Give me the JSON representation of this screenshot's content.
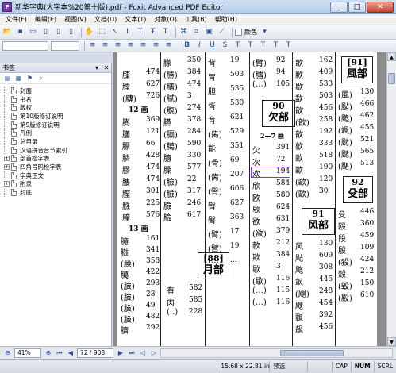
{
  "window": {
    "title": "新华字典(大字本%20第十版).pdf - Foxit Advanced PDF Editor",
    "minimize": "_",
    "maximize": "□",
    "close": "✕"
  },
  "menu": [
    "文件(F)",
    "编辑(E)",
    "视图(V)",
    "文档(D)",
    "文本(T)",
    "对象(O)",
    "工具(B)",
    "帮助(H)"
  ],
  "toolbar": {
    "color_label": "颜色"
  },
  "bookmarks": {
    "title": "书签",
    "items": [
      {
        "label": "封面",
        "expandable": false
      },
      {
        "label": "书名",
        "expandable": false
      },
      {
        "label": "版权",
        "expandable": false
      },
      {
        "label": "第10版修订说明",
        "expandable": false
      },
      {
        "label": "第9版修订说明",
        "expandable": false
      },
      {
        "label": "凡例",
        "expandable": false
      },
      {
        "label": "总目录",
        "expandable": false
      },
      {
        "label": "汉语拼音音节索引",
        "expandable": false
      },
      {
        "label": "部首检字表",
        "expandable": true
      },
      {
        "label": "四角号码检字表",
        "expandable": true
      },
      {
        "label": "字典正文",
        "expandable": false
      },
      {
        "label": "附录",
        "expandable": true
      },
      {
        "label": "封底",
        "expandable": false
      }
    ]
  },
  "page": {
    "headers": {
      "col4_box_num": "90",
      "col4_box_name": "欠部",
      "col4_sub": "2—7 画",
      "col2_box": "[88]",
      "col2_box_name": "月部",
      "col5_box_num": "91",
      "col5_box_name": "风部",
      "col6_box_top": "[91]",
      "col6_box_top_name": "風部",
      "col6_box_num": "92",
      "col6_box_name": "殳部",
      "col1_stroke1": "12 画",
      "col1_stroke2": "13 画"
    },
    "col1": [
      [
        "膝",
        "474"
      ],
      [
        "膛",
        "627"
      ],
      [
        "(膞)",
        "726"
      ],
      [
        "膨",
        "369"
      ],
      [
        "膳",
        "121"
      ],
      [
        "膘",
        "66"
      ],
      [
        "膦",
        "428"
      ],
      [
        "膠",
        "474"
      ],
      [
        "膢",
        "474"
      ],
      [
        "膣",
        "301"
      ],
      [
        "膙",
        "225"
      ],
      [
        "膧",
        "576"
      ],
      [
        "臆",
        "161"
      ],
      [
        "臌",
        "341"
      ],
      [
        "(臊)",
        "358"
      ],
      [
        "臈",
        "422"
      ],
      [
        "(臉)",
        "293"
      ],
      [
        "(臉)",
        "28"
      ],
      [
        "(臉)",
        "49"
      ],
      [
        "(臉)",
        "482"
      ],
      [
        "臍",
        "292"
      ],
      [
        "臐",
        "128"
      ]
    ],
    "col2": [
      [
        "朦",
        "350"
      ],
      [
        "(勝)",
        "384"
      ],
      [
        "(膳)",
        "474"
      ],
      [
        "(腻)",
        "3"
      ],
      [
        "(腹)",
        "274"
      ],
      [
        "臙",
        "378"
      ],
      [
        "(膈)",
        "284"
      ],
      [
        "(臈)",
        "590"
      ],
      [
        "臆",
        "330"
      ],
      [
        "臊",
        "577"
      ],
      [
        "(臉)",
        "22"
      ],
      [
        "(臉)",
        "317"
      ],
      [
        "臉",
        "246"
      ],
      [
        "臉",
        "617"
      ],
      [
        "有",
        "582"
      ],
      [
        "肉",
        "585"
      ],
      [
        "(..)",
        "228"
      ]
    ],
    "col3": [
      [
        "背",
        "19"
      ],
      [
        "胃",
        "503"
      ],
      [
        "胆",
        "535"
      ],
      [
        "胥",
        "530"
      ],
      [
        "育",
        "621"
      ],
      [
        "(胔)",
        "529"
      ],
      [
        "能",
        "351"
      ],
      [
        "(骨)",
        "69"
      ],
      [
        "(胔)",
        "207"
      ],
      [
        "(臀)",
        "606"
      ],
      [
        "臀",
        "627"
      ],
      [
        "臀",
        "363"
      ],
      [
        "(臂)",
        "17"
      ],
      [
        "(臂)",
        "19"
      ],
      [
        "(…)",
        "..."
      ]
    ],
    "col4": [
      [
        "(臂)",
        "92"
      ],
      [
        "(膤)",
        "94"
      ],
      [
        "(…)",
        "105"
      ],
      [
        "欠",
        "391"
      ],
      [
        "次",
        "72"
      ],
      [
        "欢",
        "194"
      ],
      [
        "欣",
        "584"
      ],
      [
        "欧",
        "580"
      ],
      [
        "欤",
        "624"
      ],
      [
        "欲",
        "631"
      ],
      [
        "(欲)",
        "379"
      ],
      [
        "款",
        "212"
      ],
      [
        "欺",
        "384"
      ],
      [
        "歇",
        "3"
      ],
      [
        "(歇)",
        "116"
      ],
      [
        "(…)",
        "115"
      ],
      [
        "(…)",
        "116"
      ]
    ],
    "col5": [
      [
        "歌",
        "162"
      ],
      [
        "歉",
        "409"
      ],
      [
        "歇",
        "533"
      ],
      [
        "歃",
        "503"
      ],
      [
        "歆",
        "456"
      ],
      [
        "(歆)",
        "258"
      ],
      [
        "歆",
        "192"
      ],
      [
        "歙",
        "333"
      ],
      [
        "歐",
        "518"
      ],
      [
        "歐",
        "190"
      ],
      [
        "(歐)",
        "120"
      ],
      [
        "(歐)",
        "30"
      ],
      [
        "风",
        "130"
      ],
      [
        "飐",
        "609"
      ],
      [
        "飑",
        "308"
      ],
      [
        "飒",
        "445"
      ],
      [
        "(飓)",
        "248"
      ],
      [
        "飕",
        "454"
      ],
      [
        "飘",
        "392"
      ],
      [
        "飙",
        "456"
      ]
    ],
    "col6": [
      [
        "(風)",
        "130"
      ],
      [
        "(颭)",
        "466"
      ],
      [
        "(颮)",
        "462"
      ],
      [
        "(颯)",
        "455"
      ],
      [
        "(颱)",
        "521"
      ],
      [
        "(颳)",
        "565"
      ],
      [
        "(颶)",
        "513"
      ],
      [
        "殳",
        "446"
      ],
      [
        "殴",
        "360"
      ],
      [
        "段",
        "459"
      ],
      [
        "殷",
        "109"
      ],
      [
        "(殺)",
        "424"
      ],
      [
        "殼",
        "212"
      ],
      [
        "(毀)",
        "150"
      ],
      [
        "(殿)",
        "610"
      ]
    ]
  },
  "nav": {
    "zoom": "41%",
    "page_field": "72 / 908"
  },
  "status": {
    "dimensions": "15.68 x 22.81 in",
    "mode": "预选",
    "caps": "CAP",
    "num": "NUM",
    "scrl": "SCRL"
  }
}
